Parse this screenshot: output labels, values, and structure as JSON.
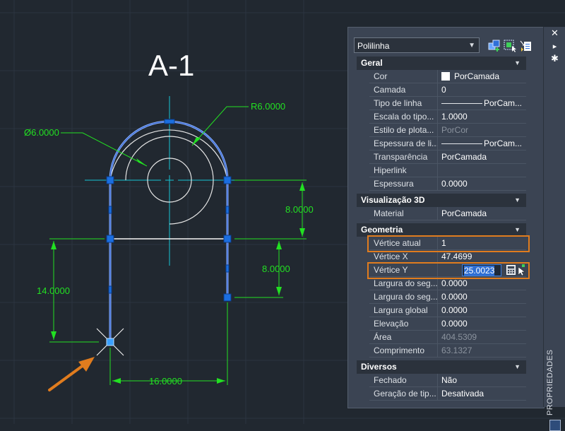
{
  "drawing": {
    "title": "A-1",
    "dims": {
      "radius": "R6.0000",
      "diameter": "Ø6.0000",
      "right_upper": "8.0000",
      "right_lower": "8.0000",
      "left": "14.0000",
      "bottom": "16.0000"
    },
    "colors": {
      "background": "#212830",
      "grid": "#2c3440",
      "geometry": "#e6e6e6",
      "selection": "#8ab4ff",
      "center_lines": "#17c3d3",
      "dimensions": "#22e022",
      "grips": "#1a6ee0",
      "annotation": "#e07c1e"
    }
  },
  "panel": {
    "selector": "Polilinha",
    "icons": [
      "toggle-pickadd-icon",
      "select-objects-icon",
      "quick-select-icon"
    ],
    "strip": {
      "close": "✕",
      "pin": "▸",
      "settings": "✱",
      "label": "PROPRIEDADES"
    },
    "sections": {
      "geral": {
        "title": "Geral",
        "rows": [
          {
            "label": "Cor",
            "value": "PorCamada"
          },
          {
            "label": "Camada",
            "value": "0"
          },
          {
            "label": "Tipo de linha",
            "value": "PorCam..."
          },
          {
            "label": "Escala do tipo...",
            "value": "1.0000"
          },
          {
            "label": "Estilo de plota...",
            "value": "PorCor"
          },
          {
            "label": "Espessura de li...",
            "value": "PorCam..."
          },
          {
            "label": "Transparência",
            "value": "PorCamada"
          },
          {
            "label": "Hiperlink",
            "value": ""
          },
          {
            "label": "Espessura",
            "value": "0.0000"
          }
        ]
      },
      "vis3d": {
        "title": "Visualização 3D",
        "rows": [
          {
            "label": "Material",
            "value": "PorCamada"
          }
        ]
      },
      "geometria": {
        "title": "Geometria",
        "rows": [
          {
            "label": "Vértice atual",
            "value": "1"
          },
          {
            "label": "Vértice X",
            "value": "47.4699"
          },
          {
            "label": "Vértice Y",
            "value": "25.0023"
          },
          {
            "label": "Largura do seg...",
            "value": "0.0000"
          },
          {
            "label": "Largura do seg...",
            "value": "0.0000"
          },
          {
            "label": "Largura global",
            "value": "0.0000"
          },
          {
            "label": "Elevação",
            "value": "0.0000"
          },
          {
            "label": "Área",
            "value": "404.5309"
          },
          {
            "label": "Comprimento",
            "value": "63.1327"
          }
        ]
      },
      "diversos": {
        "title": "Diversos",
        "rows": [
          {
            "label": "Fechado",
            "value": "Não"
          },
          {
            "label": "Geração de tip...",
            "value": "Desativada"
          }
        ]
      }
    }
  }
}
